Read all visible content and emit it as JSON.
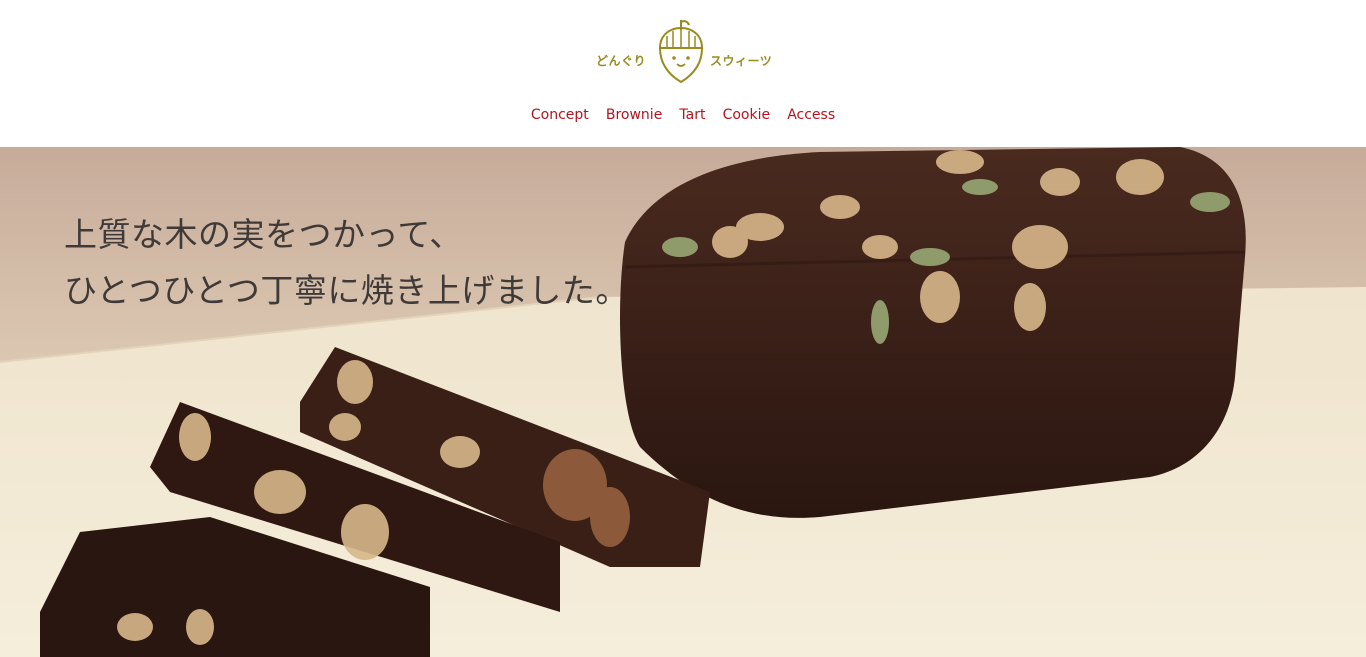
{
  "brand": {
    "name_left": "どんぐり",
    "name_right": "スウィーツ",
    "logo_icon": "acorn-face-icon",
    "color": "#9a8a1f"
  },
  "nav": {
    "color": "#b4141e",
    "items": [
      {
        "label": "Concept"
      },
      {
        "label": "Brownie"
      },
      {
        "label": "Tart"
      },
      {
        "label": "Cookie"
      },
      {
        "label": "Access"
      }
    ]
  },
  "hero": {
    "line1": "上質な木の実をつかって、",
    "line2": "ひとつひとつ丁寧に焼き上げました。",
    "image": "brownie-photo"
  }
}
